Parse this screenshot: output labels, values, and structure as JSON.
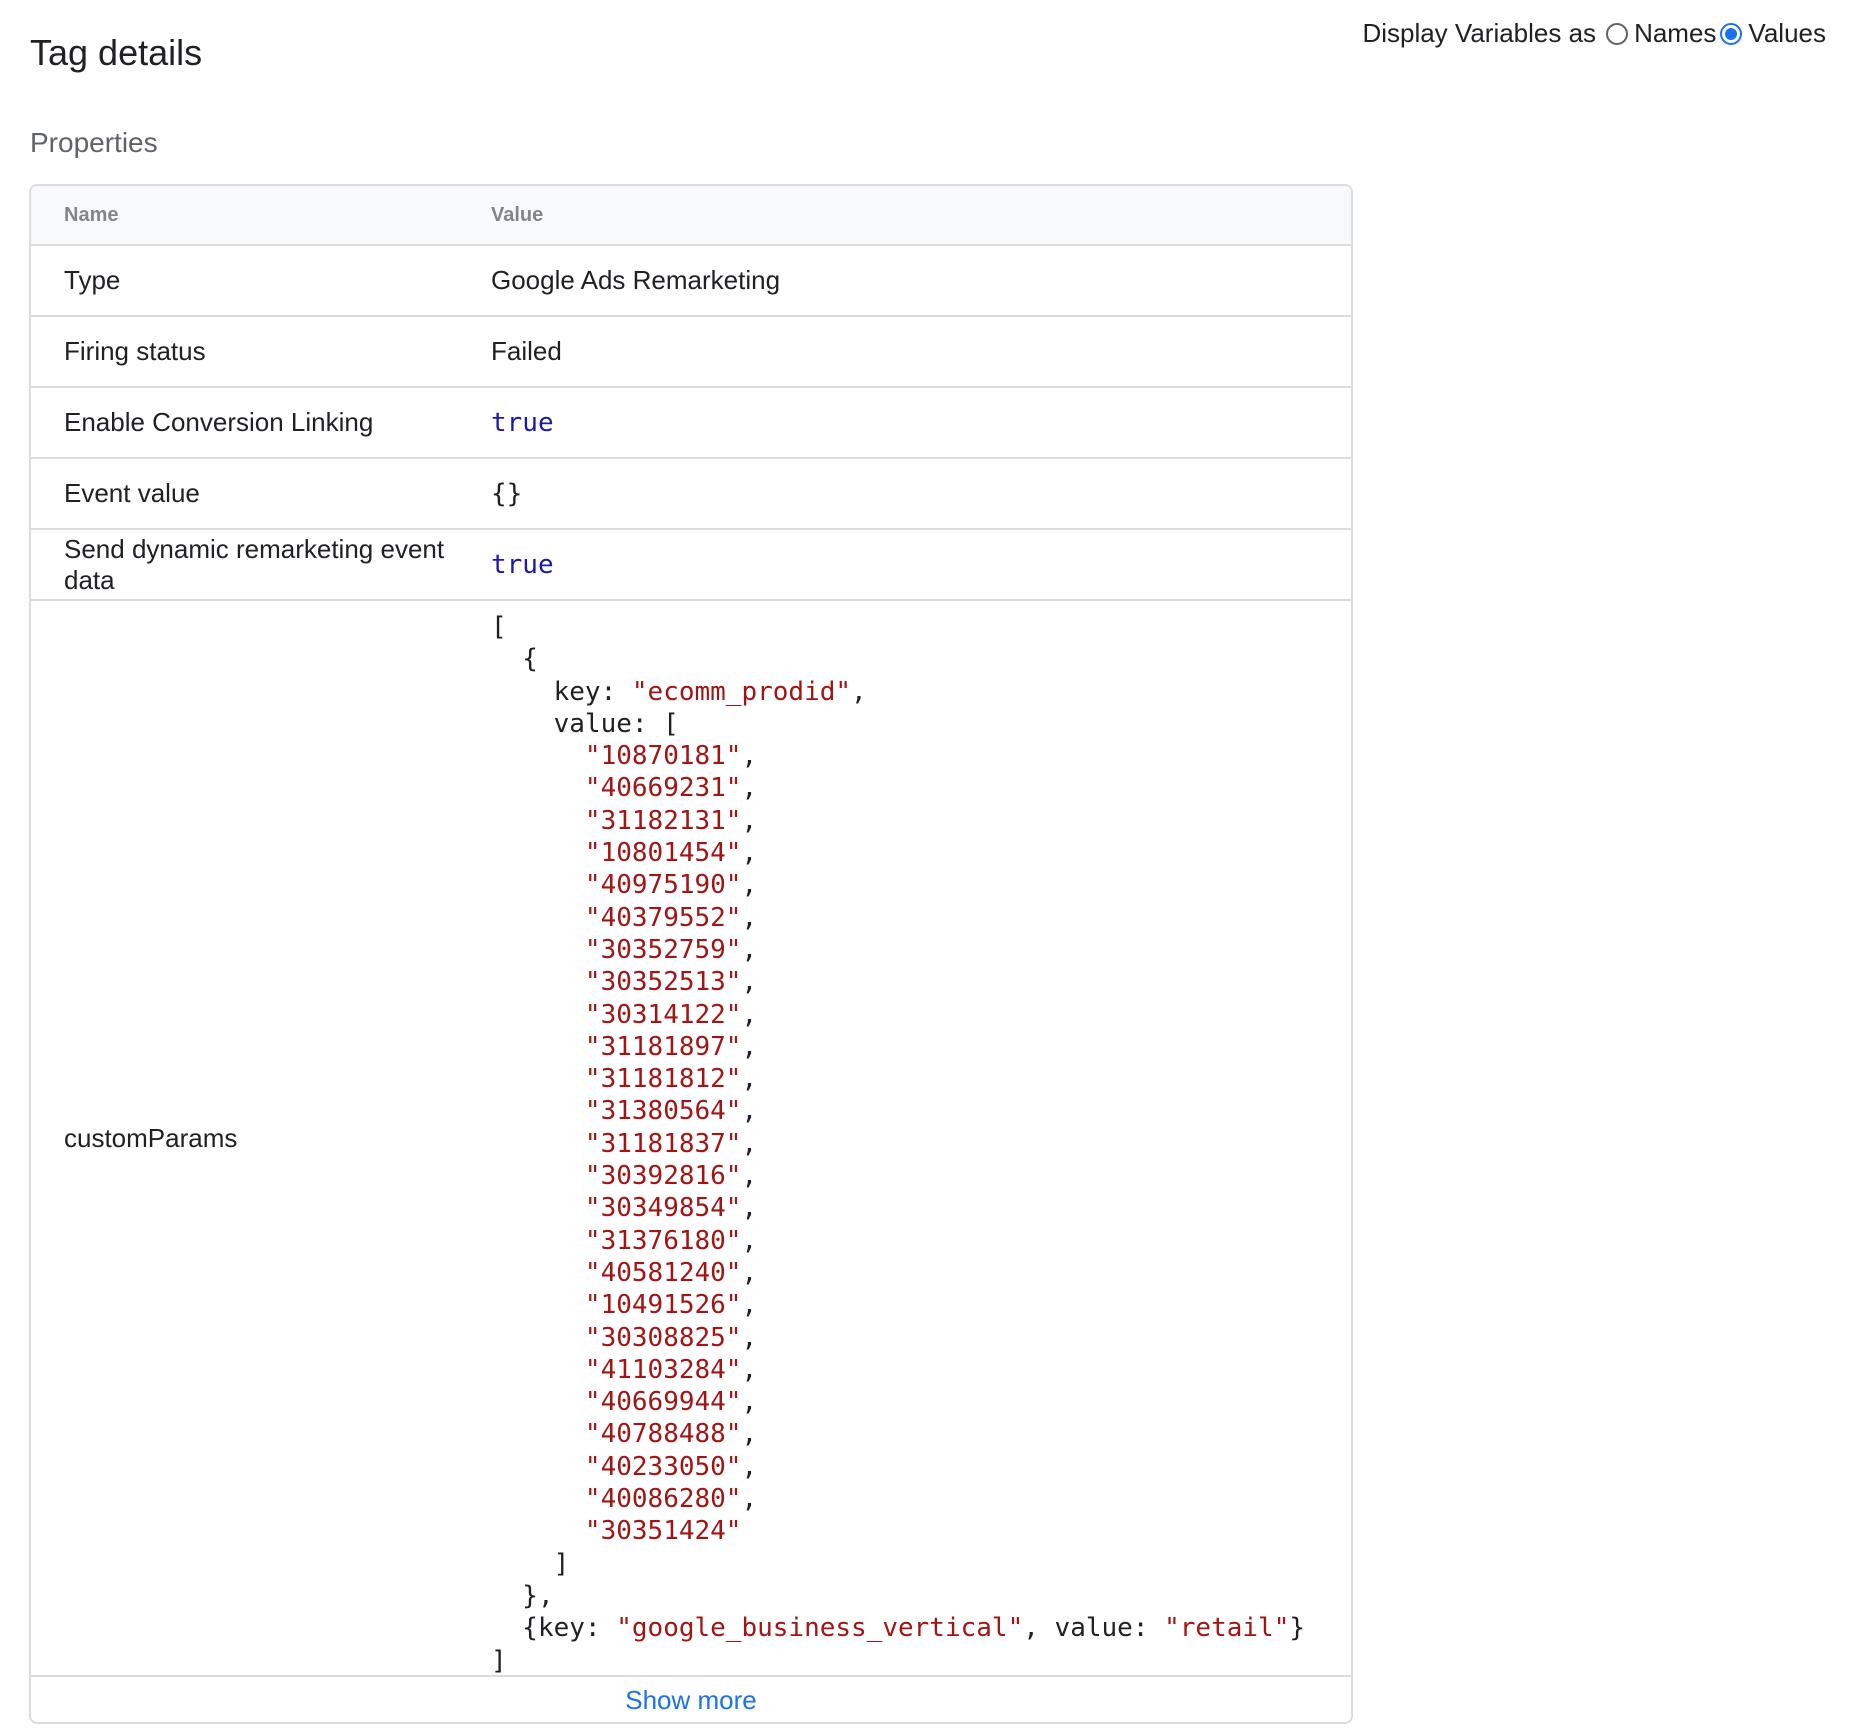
{
  "header": {
    "title": "Tag details",
    "display_vars_label": "Display Variables as",
    "options": [
      {
        "label": "Names",
        "checked": false
      },
      {
        "label": "Values",
        "checked": true
      }
    ],
    "accent_color": "#1a73e8"
  },
  "section": {
    "title": "Properties"
  },
  "table": {
    "columns": [
      "Name",
      "Value"
    ],
    "rows": [
      {
        "name": "Type",
        "value": "Google Ads Remarketing"
      },
      {
        "name": "Firing status",
        "value": "Failed"
      },
      {
        "name": "Enable Conversion Linking",
        "value": "true"
      },
      {
        "name": "Event value",
        "value": "{}"
      },
      {
        "name": "Send dynamic remarketing event data",
        "value": "true"
      }
    ],
    "custom_params": {
      "name": "customParams",
      "first_key": "\"ecomm_prodid\"",
      "product_ids": [
        "\"10870181\"",
        "\"40669231\"",
        "\"31182131\"",
        "\"10801454\"",
        "\"40975190\"",
        "\"40379552\"",
        "\"30352759\"",
        "\"30352513\"",
        "\"30314122\"",
        "\"31181897\"",
        "\"31181812\"",
        "\"31380564\"",
        "\"31181837\"",
        "\"30392816\"",
        "\"30349854\"",
        "\"31376180\"",
        "\"40581240\"",
        "\"10491526\"",
        "\"30308825\"",
        "\"41103284\"",
        "\"40669944\"",
        "\"40788488\"",
        "\"40233050\"",
        "\"40086280\"",
        "\"30351424\""
      ],
      "second_key": "\"google_business_vertical\"",
      "second_value": "\"retail\""
    },
    "show_more_label": "Show more"
  },
  "colors": {
    "keyword": "#1a1aa6",
    "string": "#a31515",
    "link": "#1a73e8"
  }
}
